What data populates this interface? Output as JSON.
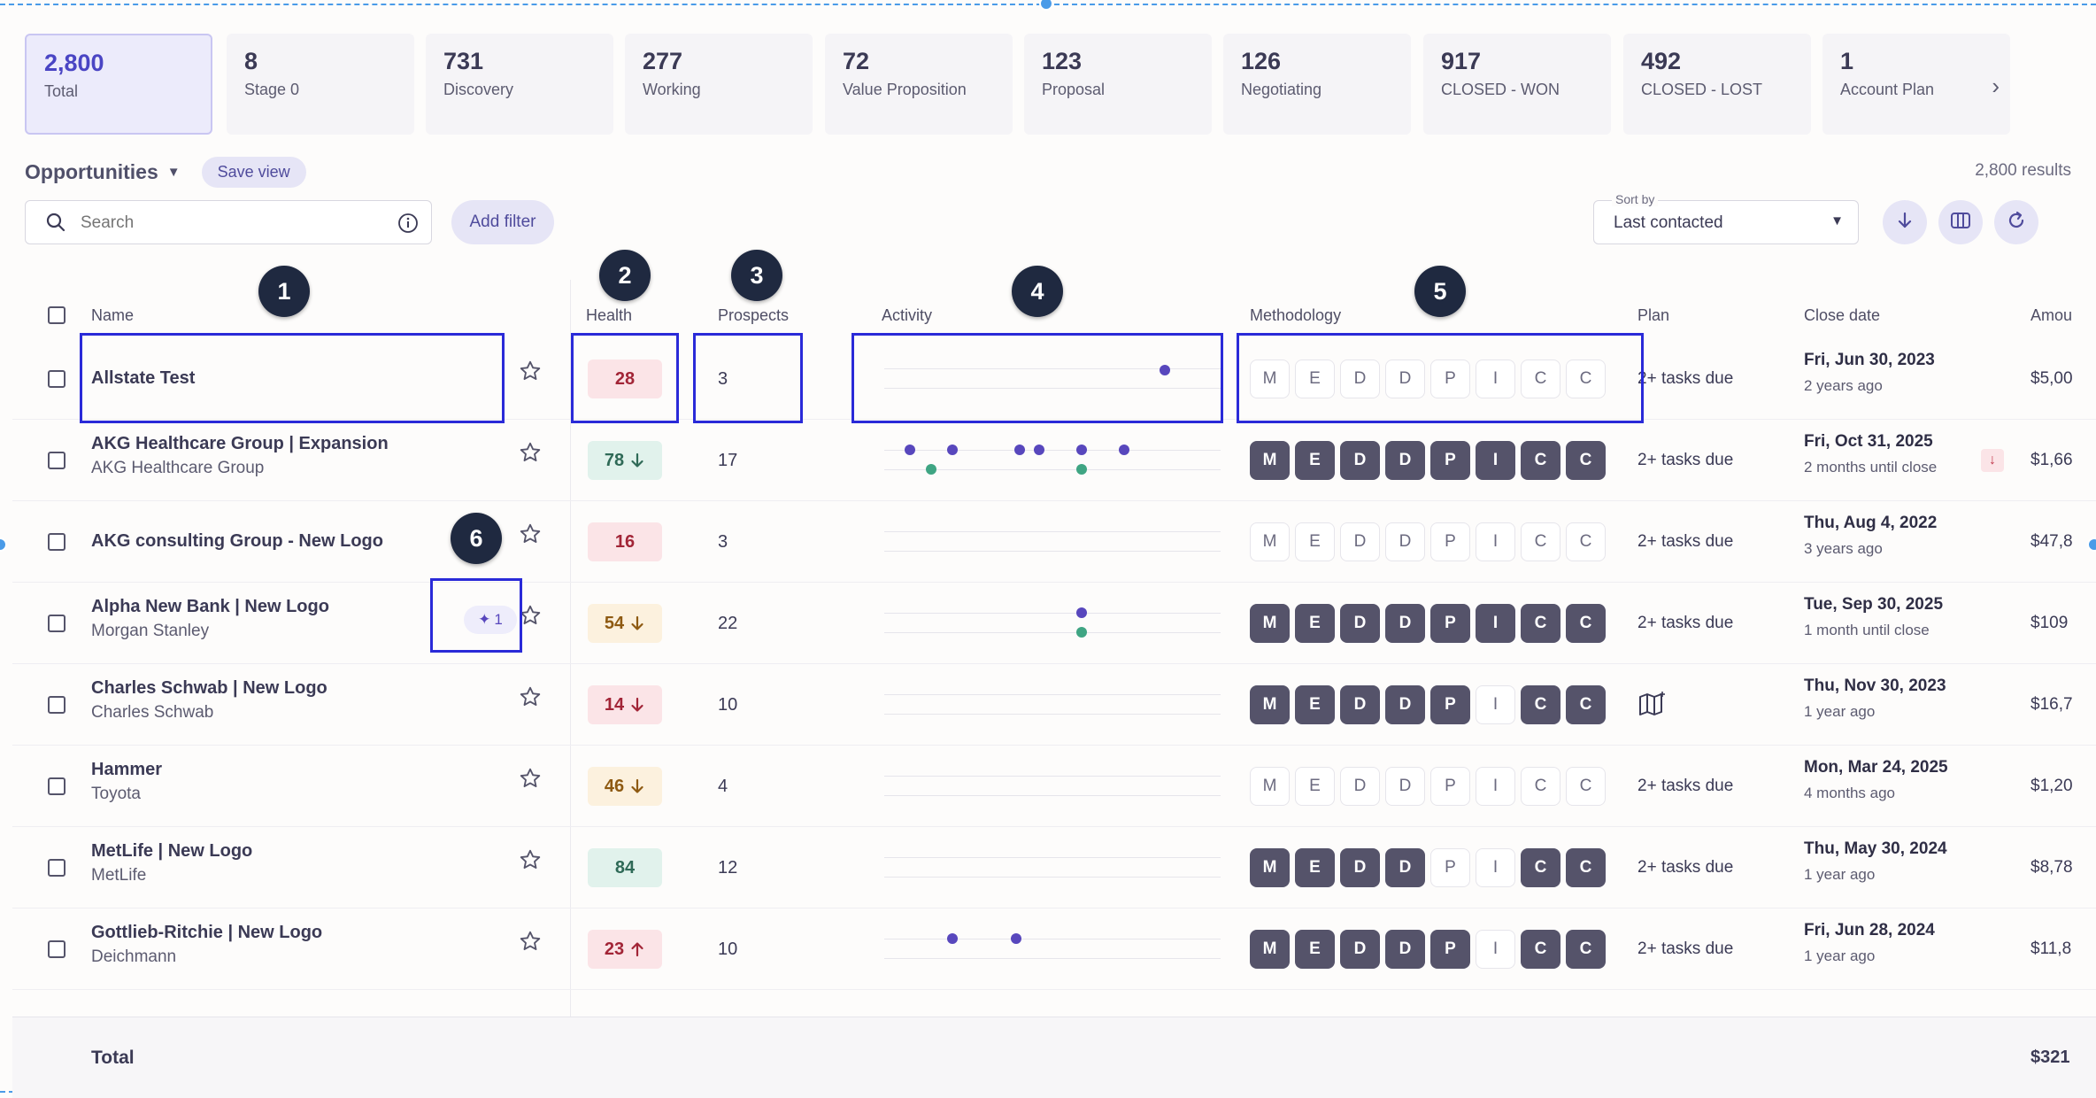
{
  "stages": [
    {
      "count": "2,800",
      "label": "Total"
    },
    {
      "count": "8",
      "label": "Stage 0"
    },
    {
      "count": "731",
      "label": "Discovery"
    },
    {
      "count": "277",
      "label": "Working"
    },
    {
      "count": "72",
      "label": "Value Proposition"
    },
    {
      "count": "123",
      "label": "Proposal"
    },
    {
      "count": "126",
      "label": "Negotiating"
    },
    {
      "count": "917",
      "label": "CLOSED - WON"
    },
    {
      "count": "492",
      "label": "CLOSED - LOST"
    },
    {
      "count": "1",
      "label": "Account Plan"
    }
  ],
  "toolbar": {
    "view_title": "Opportunities",
    "save_view": "Save view",
    "results": "2,800 results",
    "search_placeholder": "Search",
    "add_filter": "Add filter",
    "sort_label": "Sort by",
    "sort_value": "Last contacted"
  },
  "headers": {
    "name": "Name",
    "health": "Health",
    "prospects": "Prospects",
    "activity": "Activity",
    "methodology": "Methodology",
    "plan": "Plan",
    "close_date": "Close date",
    "amount": "Amou"
  },
  "methodology_letters": [
    "M",
    "E",
    "D",
    "D",
    "P",
    "I",
    "C",
    "C"
  ],
  "rows": [
    {
      "name": "Allstate Test",
      "sub": "",
      "health": "28",
      "health_tone": "red",
      "trend": "",
      "prospects": "3",
      "plan": "2+ tasks due",
      "close_date": "Fri, Jun 30, 2023",
      "close_sub": "2 years ago",
      "amount": "$5,00",
      "meth": [
        0,
        0,
        0,
        0,
        0,
        0,
        0,
        0
      ]
    },
    {
      "name": "AKG Healthcare Group | Expansion",
      "sub": "AKG Healthcare Group",
      "health": "78",
      "health_tone": "green",
      "trend": "down",
      "prospects": "17",
      "plan": "2+ tasks due",
      "close_date": "Fri, Oct 31, 2025",
      "close_sub": "2 months until close",
      "amount": "$1,66",
      "meth": [
        1,
        1,
        1,
        1,
        1,
        1,
        1,
        1
      ]
    },
    {
      "name": "AKG consulting Group - New Logo",
      "sub": "",
      "health": "16",
      "health_tone": "red",
      "trend": "",
      "prospects": "3",
      "plan": "2+ tasks due",
      "close_date": "Thu, Aug 4, 2022",
      "close_sub": "3 years ago",
      "amount": "$47,8",
      "meth": [
        0,
        0,
        0,
        0,
        0,
        0,
        0,
        0
      ]
    },
    {
      "name": "Alpha New Bank | New Logo",
      "sub": "Morgan Stanley",
      "health": "54",
      "health_tone": "orange",
      "trend": "down",
      "prospects": "22",
      "plan": "2+ tasks due",
      "close_date": "Tue, Sep 30, 2025",
      "close_sub": "1 month until close",
      "amount": "$109",
      "meth": [
        1,
        1,
        1,
        1,
        1,
        1,
        1,
        1
      ]
    },
    {
      "name": "Charles Schwab | New Logo",
      "sub": "Charles Schwab",
      "health": "14",
      "health_tone": "red",
      "trend": "down",
      "prospects": "10",
      "plan": "",
      "close_date": "Thu, Nov 30, 2023",
      "close_sub": "1 year ago",
      "amount": "$16,7",
      "meth": [
        1,
        1,
        1,
        1,
        1,
        0,
        1,
        1
      ]
    },
    {
      "name": "Hammer",
      "sub": "Toyota",
      "health": "46",
      "health_tone": "orange",
      "trend": "down",
      "prospects": "4",
      "plan": "2+ tasks due",
      "close_date": "Mon, Mar 24, 2025",
      "close_sub": "4 months ago",
      "amount": "$1,20",
      "meth": [
        0,
        0,
        0,
        0,
        0,
        0,
        0,
        0
      ]
    },
    {
      "name": "MetLife | New Logo",
      "sub": "MetLife",
      "health": "84",
      "health_tone": "green",
      "trend": "",
      "prospects": "12",
      "plan": "2+ tasks due",
      "close_date": "Thu, May 30, 2024",
      "close_sub": "1 year ago",
      "amount": "$8,78",
      "meth": [
        1,
        1,
        1,
        1,
        0,
        0,
        1,
        1
      ]
    },
    {
      "name": "Gottlieb-Ritchie | New Logo",
      "sub": "Deichmann",
      "health": "23",
      "health_tone": "red",
      "trend": "up",
      "prospects": "10",
      "plan": "2+ tasks due",
      "close_date": "Fri, Jun 28, 2024",
      "close_sub": "1 year ago",
      "amount": "$11,8",
      "meth": [
        1,
        1,
        1,
        1,
        1,
        0,
        1,
        1
      ]
    }
  ],
  "ai_chip_count": "1",
  "total": {
    "label": "Total",
    "amount": "$321"
  },
  "callouts": [
    "1",
    "2",
    "3",
    "4",
    "5",
    "6"
  ],
  "colors": {
    "accent": "#4a45c4",
    "annotation": "#2a2ad8",
    "activity_purple": "#5847bd",
    "activity_green": "#3fa583"
  }
}
